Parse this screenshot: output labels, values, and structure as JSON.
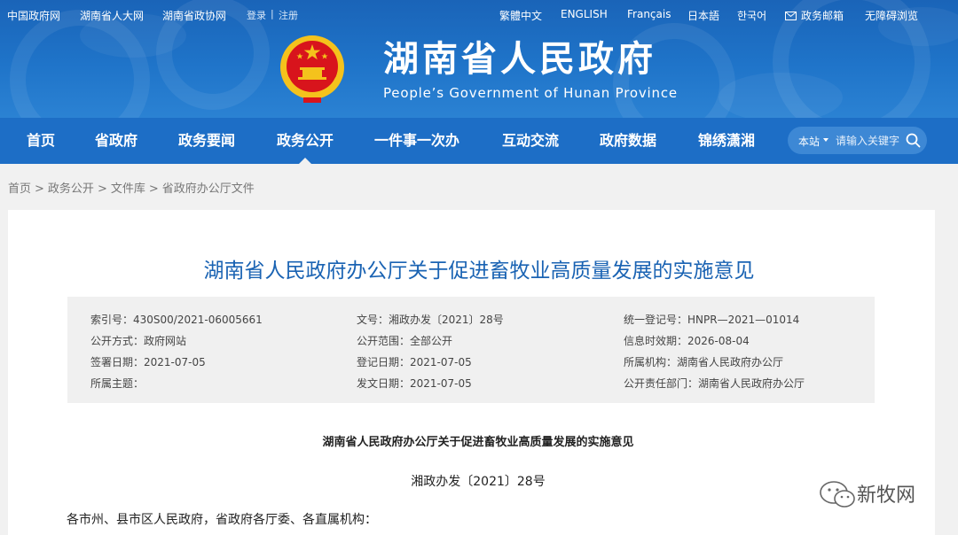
{
  "topbar": {
    "left_links": [
      "中国政府网",
      "湖南省人大网",
      "湖南省政协网"
    ],
    "login": "登录",
    "divider": "|",
    "register": "注册",
    "languages": [
      "繁體中文",
      "ENGLISH",
      "Français",
      "日本語",
      "한국어"
    ],
    "gov_mail": "政务邮箱",
    "accessibility": "无障碍浏览"
  },
  "site": {
    "title_cn": "湖南省人民政府",
    "title_en": "People’s Government of Hunan Province"
  },
  "nav": {
    "items": [
      "首页",
      "省政府",
      "政务要闻",
      "政务公开",
      "一件事一次办",
      "互动交流",
      "政府数据",
      "锦绣潇湘"
    ],
    "active_index": 3
  },
  "search": {
    "scope": "本站",
    "placeholder": "请输入关键字"
  },
  "breadcrumb": [
    "首页",
    "政务公开",
    "文件库",
    "省政府办公厅文件"
  ],
  "document": {
    "title": "湖南省人民政府办公厅关于促进畜牧业高质量发展的实施意见",
    "meta": [
      [
        "索引号：430S00/2021-06005661",
        "文号：湘政办发〔2021〕28号",
        "统一登记号：HNPR—2021—01014"
      ],
      [
        "公开方式：政府网站",
        "公开范围：全部公开",
        "信息时效期：2026-08-04"
      ],
      [
        "签署日期：2021-07-05",
        "登记日期：2021-07-05",
        "所属机构：湖南省人民政府办公厅"
      ],
      [
        "所属主题：",
        "发文日期：2021-07-05",
        "公开责任部门：湖南省人民政府办公厅"
      ]
    ],
    "sub_title": "湖南省人民政府办公厅关于促进畜牧业高质量发展的实施意见",
    "doc_no": "湘政办发〔2021〕28号",
    "addressee": "各市州、县市区人民政府，省政府各厅委、各直属机构："
  },
  "watermark": {
    "text": "新牧网",
    "icon": "wechat-icon"
  },
  "colors": {
    "header_blue": "#1f74c9",
    "nav_blue": "#1d6ec6",
    "title_blue": "#1a63b3",
    "emblem_red": "#d8141c",
    "emblem_gold": "#f4c21c"
  }
}
